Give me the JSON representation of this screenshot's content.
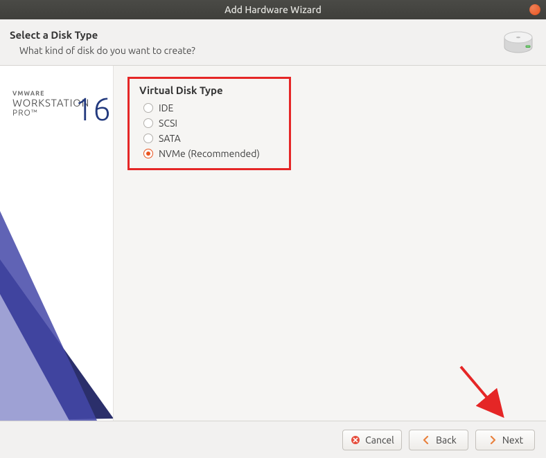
{
  "window": {
    "title": "Add Hardware Wizard"
  },
  "header": {
    "title": "Select a Disk Type",
    "subtitle": "What kind of disk do you want to create?"
  },
  "branding": {
    "vmware": "VMWARE",
    "workstation": "WORKSTATION",
    "pro": "PRO™",
    "version": "16"
  },
  "disk_type": {
    "legend": "Virtual Disk Type",
    "options": [
      {
        "label": "IDE",
        "selected": false
      },
      {
        "label": "SCSI",
        "selected": false
      },
      {
        "label": "SATA",
        "selected": false
      },
      {
        "label": "NVMe (Recommended)",
        "selected": true
      }
    ]
  },
  "footer": {
    "cancel": "Cancel",
    "back": "Back",
    "next": "Next"
  },
  "annotation": {
    "highlight_target": "disk_type_group",
    "arrow_target": "next_button"
  }
}
